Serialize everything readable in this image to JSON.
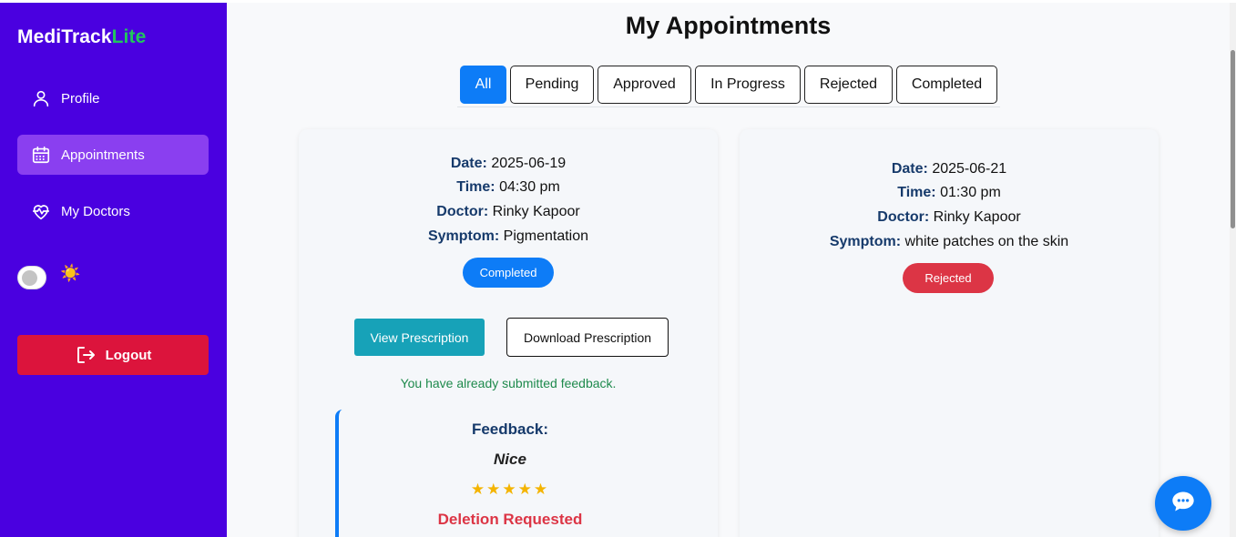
{
  "brand": {
    "name_main": "MediTrack",
    "name_accent": "Lite",
    "accent_color": "#22c55e"
  },
  "sidebar": {
    "bg_color": "#4a00e0",
    "items": [
      {
        "label": "Profile",
        "icon": "user-icon",
        "active": false
      },
      {
        "label": "Appointments",
        "icon": "calendar-icon",
        "active": true
      },
      {
        "label": "My Doctors",
        "icon": "heart-pulse-icon",
        "active": false
      }
    ],
    "theme_toggle": {
      "state": "off",
      "icon": "☀️"
    },
    "logout_label": "Logout"
  },
  "page": {
    "title": "My Appointments"
  },
  "tabs": [
    {
      "label": "All",
      "active": true
    },
    {
      "label": "Pending",
      "active": false
    },
    {
      "label": "Approved",
      "active": false
    },
    {
      "label": "In Progress",
      "active": false
    },
    {
      "label": "Rejected",
      "active": false
    },
    {
      "label": "Completed",
      "active": false
    }
  ],
  "labels": {
    "date": "Date:",
    "time": "Time:",
    "doctor": "Doctor:",
    "symptom": "Symptom:"
  },
  "appointments": [
    {
      "date": "2025-06-19",
      "time": "04:30 pm",
      "doctor": "Rinky Kapoor",
      "symptom": "Pigmentation",
      "status": "Completed",
      "status_color": "#0d7cf7",
      "view_prescription_label": "View Prescription",
      "download_prescription_label": "Download Prescription",
      "feedback_note": "You have already submitted feedback.",
      "feedback": {
        "title": "Feedback:",
        "text": "Nice",
        "stars": "★★★★★",
        "rating": 5,
        "deletion_status": "Deletion Requested"
      }
    },
    {
      "date": "2025-06-21",
      "time": "01:30 pm",
      "doctor": "Rinky Kapoor",
      "symptom": "white patches on the skin",
      "status": "Rejected",
      "status_color": "#dc3545"
    }
  ],
  "chat": {
    "icon": "chat-bubble-icon"
  }
}
